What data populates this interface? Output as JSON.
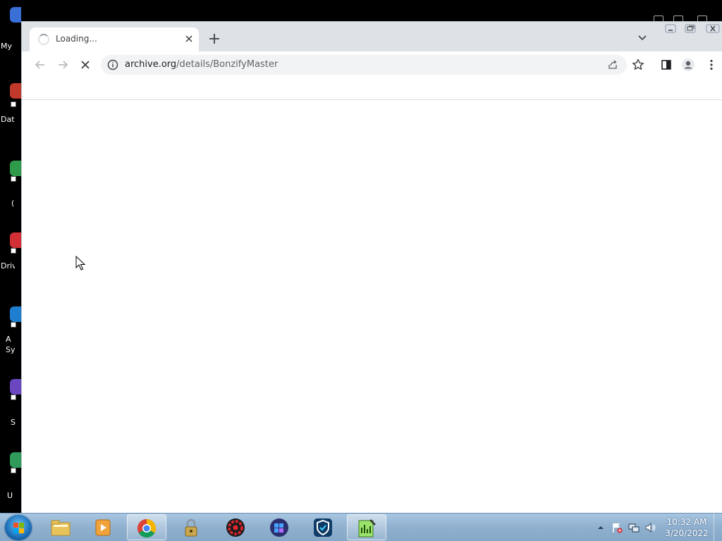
{
  "desktop": {
    "icons": [
      {
        "label": "My",
        "color": "#3a6fd8"
      },
      {
        "label": "Dat",
        "color": "#c0392b"
      },
      {
        "label": "(",
        "color": "#2e9a4a"
      },
      {
        "label": "Driv",
        "color": "#d22f36"
      },
      {
        "label": "A\nSy",
        "color": "#1e7fd0"
      },
      {
        "label": "S",
        "color": "#6b46c1"
      },
      {
        "label": "U",
        "color": "#2f9a5a"
      }
    ]
  },
  "browser": {
    "tab": {
      "title": "Loading...",
      "state": "loading"
    },
    "address": {
      "host": "archive.org",
      "path": "/details/BonzifyMaster"
    }
  },
  "icons": {
    "tab_close": "close-icon",
    "new_tab": "plus-icon",
    "tab_search": "chevron-down-icon",
    "back": "arrow-left-icon",
    "forward": "arrow-right-icon",
    "stop": "close-icon",
    "site_info": "info-icon",
    "share": "share-icon",
    "bookmark": "star-icon",
    "side_panel": "side-panel-icon",
    "profile": "person-icon",
    "menu": "kebab-menu-icon"
  },
  "taskbar": {
    "items": [
      {
        "name": "file-explorer",
        "open": false
      },
      {
        "name": "media-player",
        "open": false
      },
      {
        "name": "chrome",
        "open": true
      },
      {
        "name": "security-lock",
        "open": false
      },
      {
        "name": "red-app",
        "open": false
      },
      {
        "name": "windows-update-tool",
        "open": false
      },
      {
        "name": "shield-app",
        "open": false
      },
      {
        "name": "notepad-chart",
        "open": true
      }
    ],
    "clock": {
      "time": "10:32 AM",
      "date": "3/20/2022"
    }
  },
  "colors": {
    "accent": "#1a73e8",
    "tabstrip": "#dee1e6",
    "taskbar": "#9ab8d6"
  }
}
